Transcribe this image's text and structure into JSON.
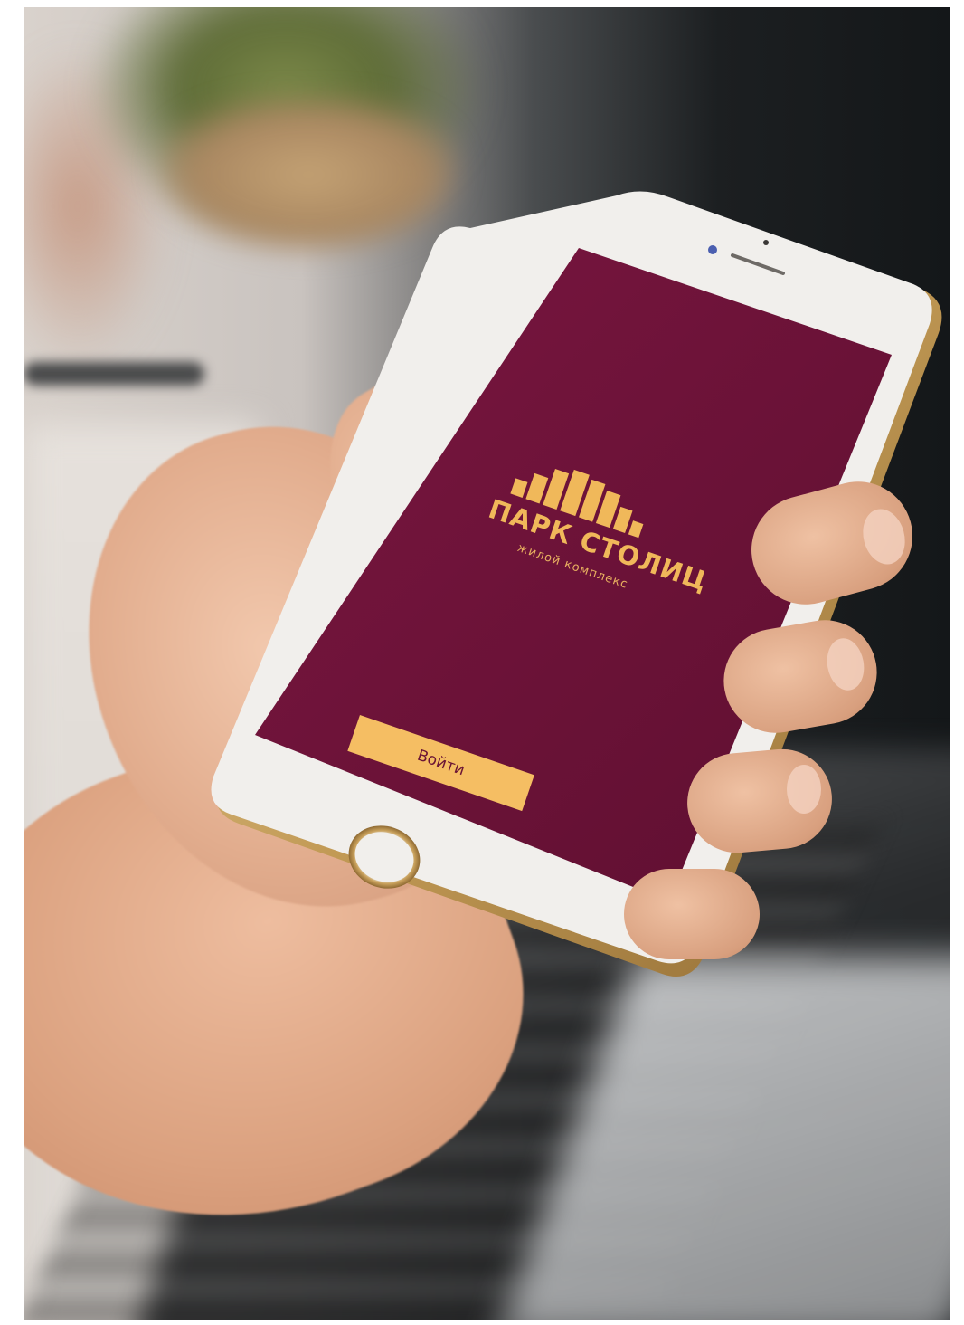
{
  "screen": {
    "brand": {
      "title": "ПАРК СТОЛИЦ",
      "subtitle": "жилой комплекс"
    },
    "login_button_label": "Войти"
  },
  "colors": {
    "screen_background": "#6e1238",
    "accent_gold": "#f5be63",
    "phone_body": "#f1efec",
    "phone_rim": "#c9a15c"
  },
  "icons": {
    "logo": "city-skyline-logo-icon",
    "home_button": "home-button-ring-icon"
  }
}
